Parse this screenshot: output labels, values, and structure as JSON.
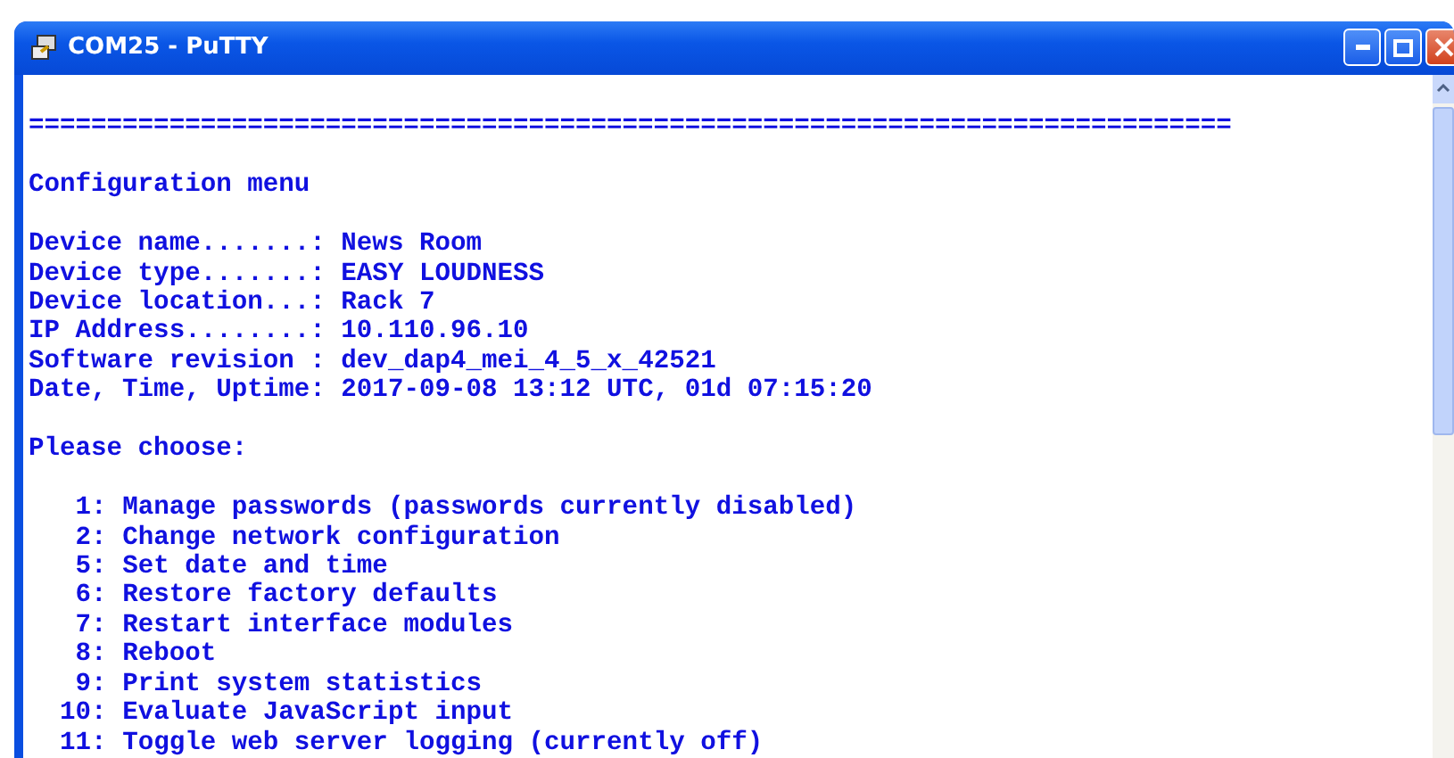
{
  "window": {
    "title": "COM25 - PuTTY"
  },
  "terminal": {
    "separator": "=============================================================================",
    "heading": "Configuration menu",
    "info": [
      {
        "label": "Device name.......:",
        "value": "News Room"
      },
      {
        "label": "Device type.......:",
        "value": "EASY LOUDNESS"
      },
      {
        "label": "Device location...:",
        "value": "Rack 7"
      },
      {
        "label": "IP Address........:",
        "value": "10.110.96.10"
      },
      {
        "label": "Software revision :",
        "value": "dev_dap4_mei_4_5_x_42521"
      },
      {
        "label": "Date, Time, Uptime:",
        "value": "2017-09-08 13:12 UTC, 01d 07:15:20"
      }
    ],
    "prompt": "Please choose:",
    "options": [
      {
        "number": "1:",
        "label": "Manage passwords (passwords currently disabled)"
      },
      {
        "number": "2:",
        "label": "Change network configuration"
      },
      {
        "number": "5:",
        "label": "Set date and time"
      },
      {
        "number": "6:",
        "label": "Restore factory defaults"
      },
      {
        "number": "7:",
        "label": "Restart interface modules"
      },
      {
        "number": "8:",
        "label": "Reboot"
      },
      {
        "number": "9:",
        "label": "Print system statistics"
      },
      {
        "number": "10:",
        "label": "Evaluate JavaScript input"
      },
      {
        "number": "11:",
        "label": "Toggle web server logging (currently off)"
      }
    ]
  }
}
